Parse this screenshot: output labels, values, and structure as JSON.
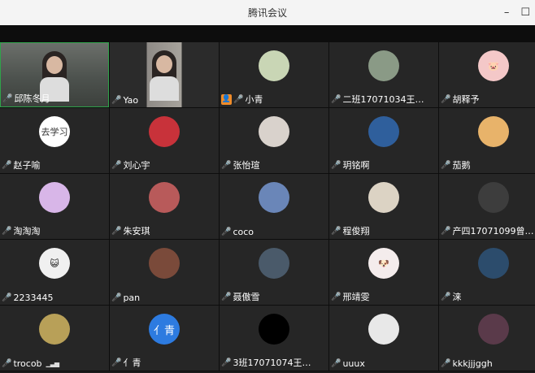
{
  "window": {
    "title": "腾讯会议",
    "min_glyph": "–",
    "max_glyph": "☐"
  },
  "participants": [
    {
      "name": "邱陈冬月",
      "type": "video1",
      "avatar_text": ""
    },
    {
      "name": "Yao",
      "type": "video2",
      "avatar_text": ""
    },
    {
      "name": "小青",
      "type": "avatar",
      "color": "#c9d6b5",
      "avatar_text": ""
    },
    {
      "name": "二班17071034王…",
      "type": "avatar",
      "color": "#8a9a86",
      "avatar_text": ""
    },
    {
      "name": "胡释予",
      "type": "avatar",
      "color": "#f4c8c8",
      "avatar_text": "🐷"
    },
    {
      "name": "赵子喻",
      "type": "avatar-text",
      "avatar_text": "去学习"
    },
    {
      "name": "刘心宇",
      "type": "avatar",
      "color": "#c8323a",
      "avatar_text": ""
    },
    {
      "name": "张怡瑄",
      "type": "avatar",
      "color": "#d9d2cc",
      "avatar_text": ""
    },
    {
      "name": "玥铭啊",
      "type": "avatar",
      "color": "#2f5f9c",
      "avatar_text": ""
    },
    {
      "name": "茄鹅",
      "type": "avatar",
      "color": "#e8b36a",
      "avatar_text": ""
    },
    {
      "name": "淘淘淘",
      "type": "avatar",
      "color": "#d8b6e8",
      "avatar_text": ""
    },
    {
      "name": "朱安琪",
      "type": "avatar",
      "color": "#b85a5a",
      "avatar_text": ""
    },
    {
      "name": "coco",
      "type": "avatar",
      "color": "#6a86b8",
      "avatar_text": ""
    },
    {
      "name": "程俊翔",
      "type": "avatar",
      "color": "#dcd3c4",
      "avatar_text": ""
    },
    {
      "name": "产四17071099曾…",
      "type": "avatar",
      "color": "#3d3d3d",
      "avatar_text": ""
    },
    {
      "name": "2233445",
      "type": "avatar",
      "color": "#f0f0f0",
      "avatar_text": "😺"
    },
    {
      "name": "pan",
      "type": "avatar",
      "color": "#7a4a3a",
      "avatar_text": ""
    },
    {
      "name": "聂傲雪",
      "type": "avatar",
      "color": "#4a5a6a",
      "avatar_text": ""
    },
    {
      "name": "邢靖雯",
      "type": "avatar",
      "color": "#f4ecec",
      "avatar_text": "🐶"
    },
    {
      "name": "涞",
      "type": "avatar",
      "color": "#2c4c6c",
      "avatar_text": ""
    },
    {
      "name": "trocob",
      "type": "avatar",
      "color": "#b8a058",
      "avatar_text": ""
    },
    {
      "name": "亻青",
      "type": "avatar-blue",
      "avatar_text": "亻青"
    },
    {
      "name": "3班17071074王…",
      "type": "avatar-black",
      "avatar_text": ""
    },
    {
      "name": "uuux",
      "type": "avatar",
      "color": "#e8e8e8",
      "avatar_text": ""
    },
    {
      "name": "kkkjjjggh",
      "type": "avatar",
      "color": "#5a3a4a",
      "avatar_text": ""
    }
  ],
  "badges": {
    "mic_glyph": "🎤",
    "role_glyph": "👤",
    "signal_glyph": "▁▃▅"
  }
}
